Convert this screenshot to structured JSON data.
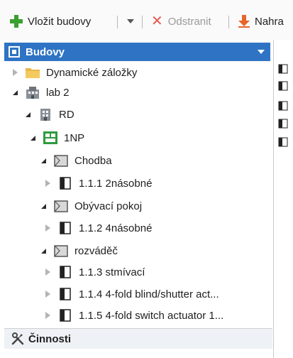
{
  "toolbar": {
    "add_label": "Vložit budovy",
    "remove_label": "Odstranit",
    "replace_label": "Nahra"
  },
  "panel": {
    "title": "Budovy",
    "footer_label": "Činnosti"
  },
  "tree": [
    {
      "label": "Dynamické záložky",
      "icon": "folder-icon",
      "state": "collapsed",
      "level": 0
    },
    {
      "label": "lab 2",
      "icon": "building-icon",
      "state": "expanded",
      "level": 0
    },
    {
      "label": "RD",
      "icon": "house-icon",
      "state": "expanded",
      "level": 1
    },
    {
      "label": "1NP",
      "icon": "floor-icon",
      "state": "expanded",
      "level": 2
    },
    {
      "label": "Chodba",
      "icon": "room-icon",
      "state": "expanded",
      "level": 3
    },
    {
      "label": "1.1.1 2násobné",
      "icon": "device-icon",
      "state": "collapsed",
      "level": 4
    },
    {
      "label": "Obývací pokoj",
      "icon": "room-icon",
      "state": "expanded",
      "level": 3
    },
    {
      "label": "1.1.2 4násobné",
      "icon": "device-icon",
      "state": "collapsed",
      "level": 4
    },
    {
      "label": "rozváděč",
      "icon": "room-icon",
      "state": "expanded",
      "level": 3
    },
    {
      "label": "1.1.3 stmívací",
      "icon": "device-icon",
      "state": "collapsed",
      "level": 4
    },
    {
      "label": "1.1.4 4-fold blind/shutter act...",
      "icon": "device-icon",
      "state": "collapsed",
      "level": 4
    },
    {
      "label": "1.1.5 4-fold switch actuator 1...",
      "icon": "device-icon",
      "state": "collapsed",
      "level": 4
    }
  ],
  "colors": {
    "header_blue": "#2f74c4",
    "add_green": "#3aa02f",
    "remove_red": "#e55a4f",
    "replace_orange": "#e8652b",
    "floor_green": "#2f9a3f"
  }
}
